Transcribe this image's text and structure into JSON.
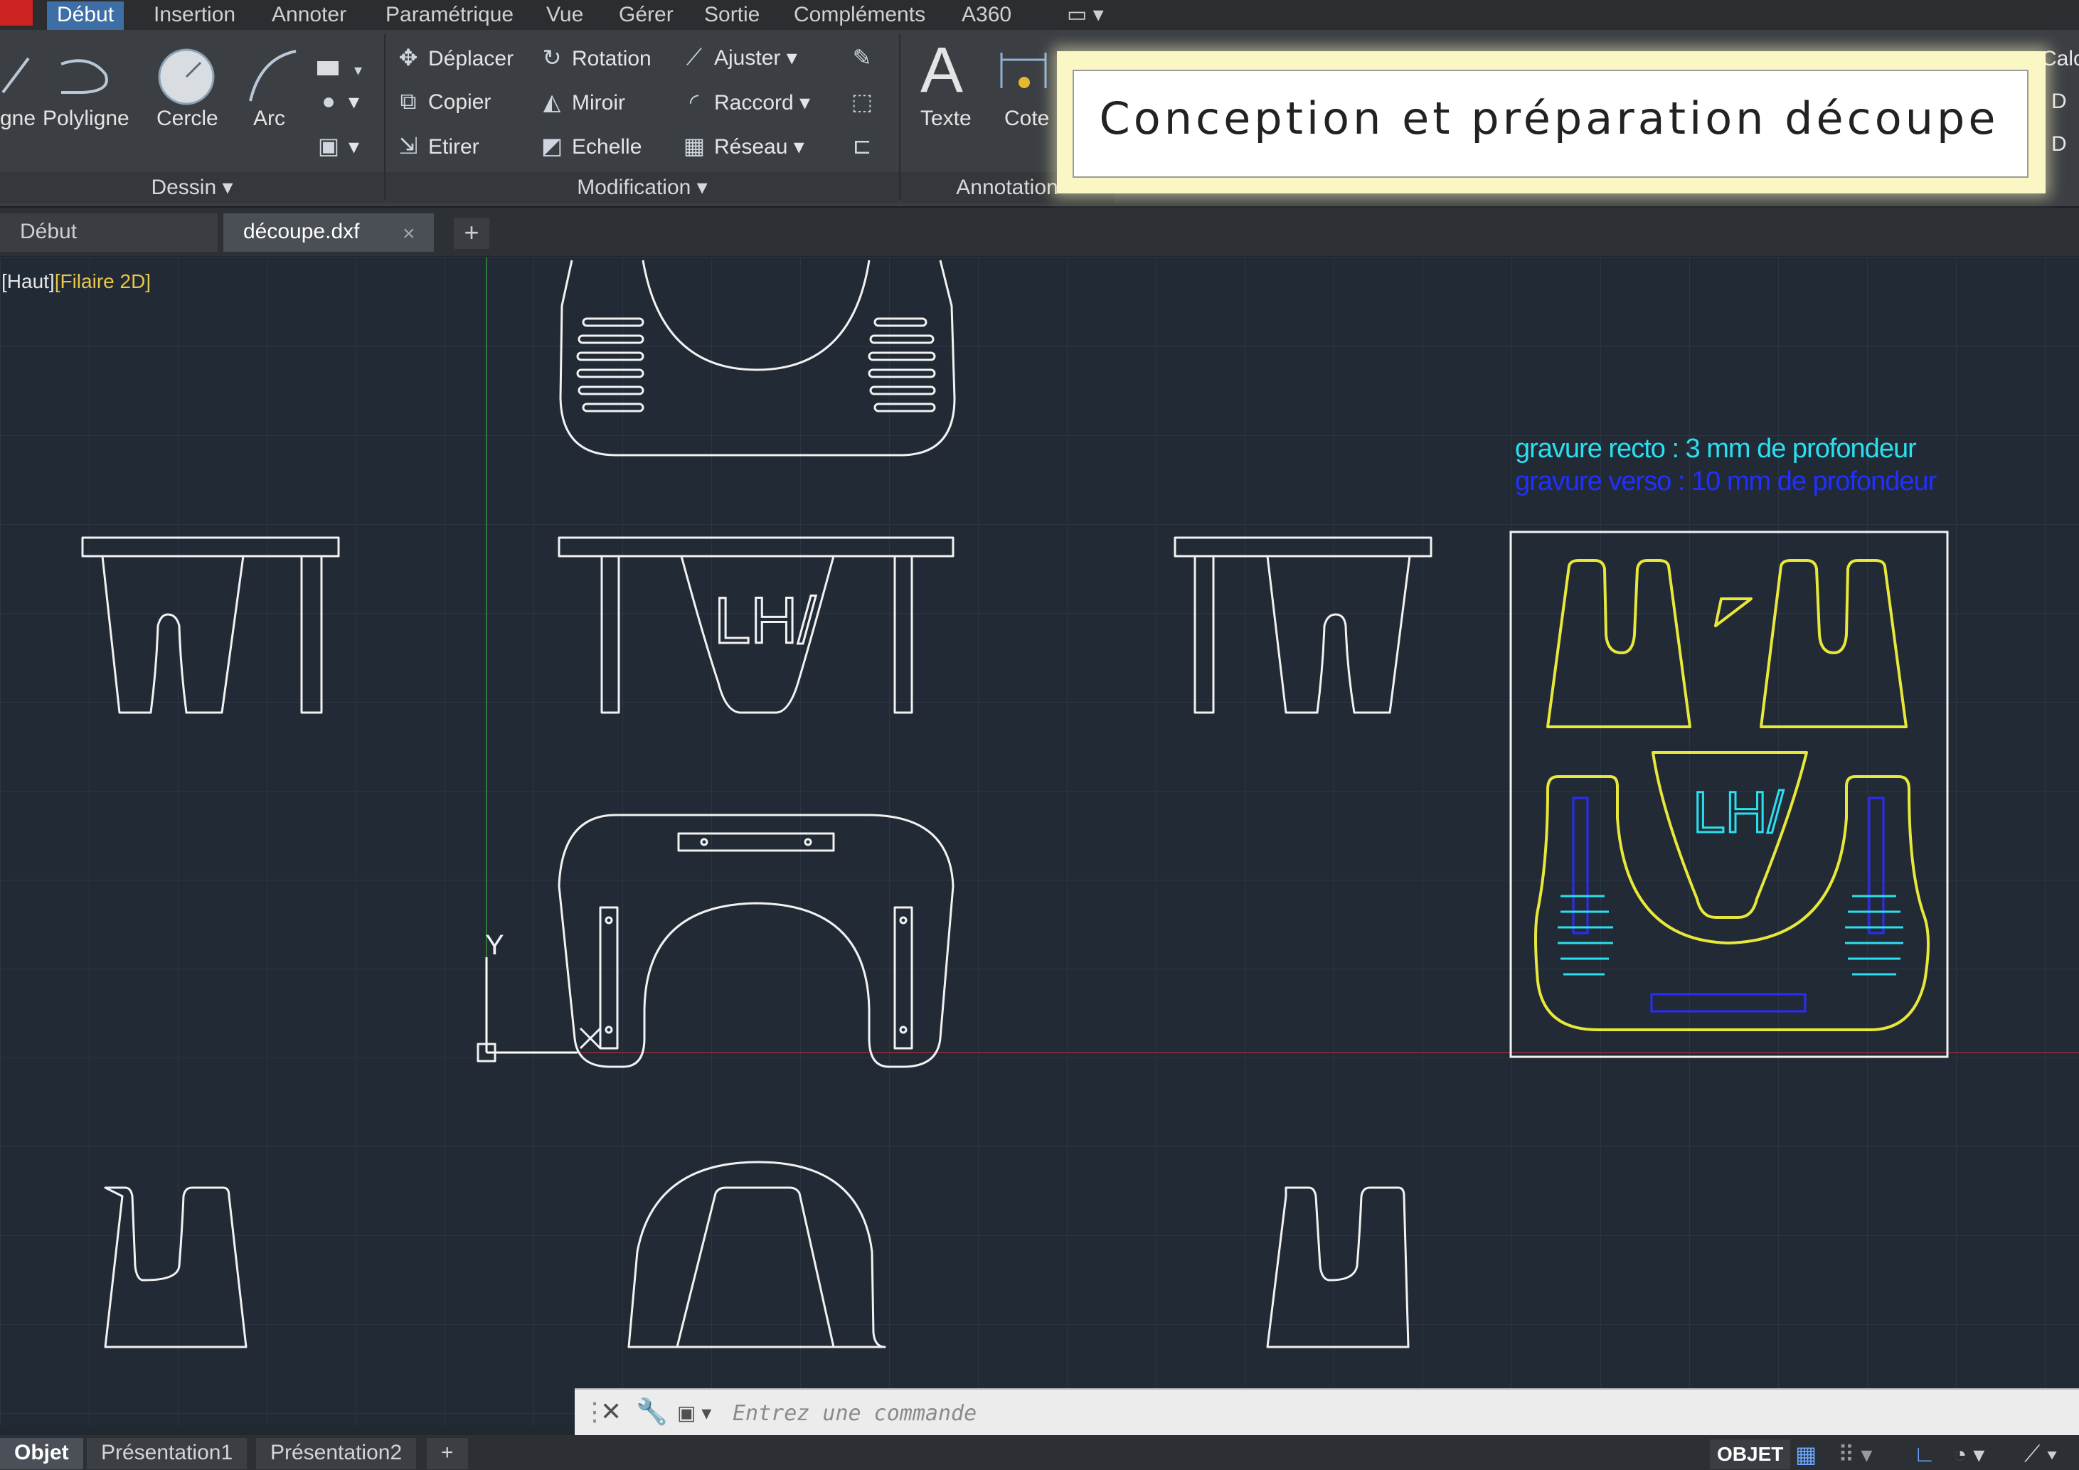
{
  "menu": {
    "items": [
      "Début",
      "Insertion",
      "Annoter",
      "Paramétrique",
      "Vue",
      "Gérer",
      "Sortie",
      "Compléments",
      "A360"
    ]
  },
  "ribbon": {
    "draw": {
      "ligne": "gne",
      "polyligne": "Polyligne",
      "cercle": "Cercle",
      "arc": "Arc",
      "panel": "Dessin"
    },
    "modify": {
      "deplacer": "Déplacer",
      "rotation": "Rotation",
      "ajuster": "Ajuster",
      "copier": "Copier",
      "miroir": "Miroir",
      "raccord": "Raccord",
      "etirer": "Etirer",
      "echelle": "Echelle",
      "reseau": "Réseau",
      "panel": "Modification"
    },
    "annotation": {
      "texte": "Texte",
      "cote": "Cote",
      "panel": "Annotation"
    },
    "right_edge": {
      "calc": "Calc",
      "d1": "D",
      "d2": "D"
    }
  },
  "overlay_title": "Conception et préparation découpe",
  "file_tabs": {
    "home": "Début",
    "current": "découpe.dxf",
    "close": "×",
    "add": "+"
  },
  "viewport": {
    "view": "[Haut]",
    "mode": "[Filaire 2D]"
  },
  "drawing": {
    "note_recto": "gravure recto : 3 mm de profondeur",
    "note_verso": "gravure verso : 10 mm de profondeur",
    "logo_text": "LH/",
    "axis_y": "Y",
    "colors": {
      "background": "#222a35",
      "lines": "#f2f2f2",
      "cut": "#e8e83a",
      "recto": "#29e0f0",
      "verso": "#2030ff"
    }
  },
  "command": {
    "placeholder": "Entrez une commande"
  },
  "layout_tabs": [
    "Objet",
    "Présentation1",
    "Présentation2",
    "+"
  ],
  "status": {
    "model": "OBJET"
  }
}
